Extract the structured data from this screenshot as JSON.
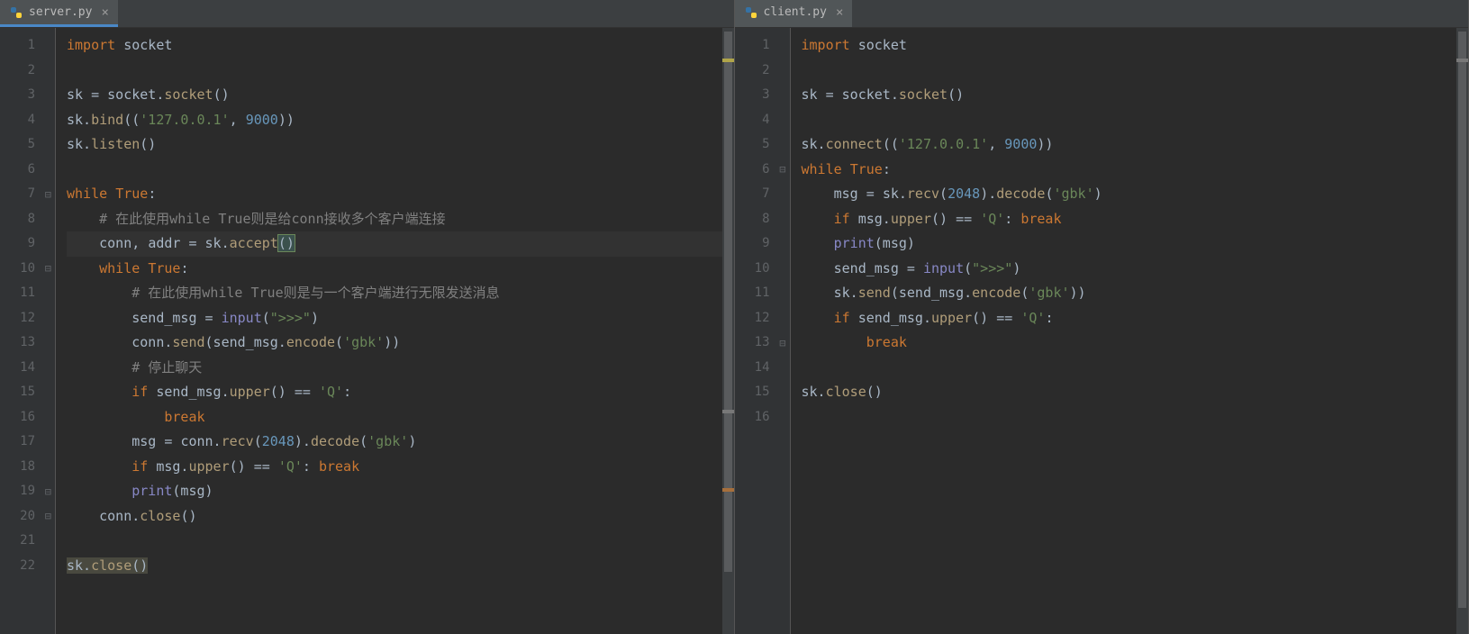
{
  "left": {
    "tab": {
      "filename": "server.py"
    },
    "current_line_index": 8,
    "line_numbers": [
      "1",
      "2",
      "3",
      "4",
      "5",
      "6",
      "7",
      "8",
      "9",
      "10",
      "11",
      "12",
      "13",
      "14",
      "15",
      "16",
      "17",
      "18",
      "19",
      "20",
      "21",
      "22"
    ],
    "fold_marks": {
      "6": "⊟",
      "9": "⊟",
      "18": "⊟",
      "19": "⊟"
    },
    "tokens": [
      [
        {
          "t": "import ",
          "c": "kw"
        },
        {
          "t": "socket",
          "c": "ident"
        }
      ],
      [],
      [
        {
          "t": "sk ",
          "c": "ident"
        },
        {
          "t": "= ",
          "c": "punct"
        },
        {
          "t": "socket.",
          "c": "ident"
        },
        {
          "t": "socket",
          "c": "fncall"
        },
        {
          "t": "()",
          "c": "punct"
        }
      ],
      [
        {
          "t": "sk.",
          "c": "ident"
        },
        {
          "t": "bind",
          "c": "fncall"
        },
        {
          "t": "((",
          "c": "punct"
        },
        {
          "t": "'127.0.0.1'",
          "c": "str"
        },
        {
          "t": ", ",
          "c": "punct"
        },
        {
          "t": "9000",
          "c": "num"
        },
        {
          "t": "))",
          "c": "punct"
        }
      ],
      [
        {
          "t": "sk.",
          "c": "ident"
        },
        {
          "t": "listen",
          "c": "fncall"
        },
        {
          "t": "()",
          "c": "punct"
        }
      ],
      [],
      [
        {
          "t": "while ",
          "c": "kw"
        },
        {
          "t": "True",
          "c": "kw"
        },
        {
          "t": ":",
          "c": "punct"
        }
      ],
      [
        {
          "t": "    ",
          "c": ""
        },
        {
          "t": "# 在此使用while True则是给conn接收多个客户端连接",
          "c": "comment"
        }
      ],
      [
        {
          "t": "    conn",
          "c": "ident"
        },
        {
          "t": ", ",
          "c": "punct"
        },
        {
          "t": "addr ",
          "c": "ident"
        },
        {
          "t": "= ",
          "c": "punct"
        },
        {
          "t": "sk.",
          "c": "ident"
        },
        {
          "t": "accept",
          "c": "fncall"
        },
        {
          "t": "()",
          "c": "punct paren-match"
        }
      ],
      [
        {
          "t": "    ",
          "c": ""
        },
        {
          "t": "while ",
          "c": "kw"
        },
        {
          "t": "True",
          "c": "kw"
        },
        {
          "t": ":",
          "c": "punct"
        }
      ],
      [
        {
          "t": "        ",
          "c": ""
        },
        {
          "t": "# 在此使用while True则是与一个客户端进行无限发送消息",
          "c": "comment"
        }
      ],
      [
        {
          "t": "        send_msg ",
          "c": "ident"
        },
        {
          "t": "= ",
          "c": "punct"
        },
        {
          "t": "input",
          "c": "builtin"
        },
        {
          "t": "(",
          "c": "punct"
        },
        {
          "t": "\">>>\"",
          "c": "str"
        },
        {
          "t": ")",
          "c": "punct"
        }
      ],
      [
        {
          "t": "        conn.",
          "c": "ident"
        },
        {
          "t": "send",
          "c": "fncall"
        },
        {
          "t": "(send_msg.",
          "c": "ident"
        },
        {
          "t": "encode",
          "c": "fncall"
        },
        {
          "t": "(",
          "c": "punct"
        },
        {
          "t": "'gbk'",
          "c": "str"
        },
        {
          "t": "))",
          "c": "punct"
        }
      ],
      [
        {
          "t": "        ",
          "c": ""
        },
        {
          "t": "# 停止聊天",
          "c": "comment"
        }
      ],
      [
        {
          "t": "        ",
          "c": ""
        },
        {
          "t": "if ",
          "c": "kw"
        },
        {
          "t": "send_msg.",
          "c": "ident"
        },
        {
          "t": "upper",
          "c": "fncall"
        },
        {
          "t": "() ",
          "c": "punct"
        },
        {
          "t": "== ",
          "c": "punct"
        },
        {
          "t": "'Q'",
          "c": "str"
        },
        {
          "t": ":",
          "c": "punct"
        }
      ],
      [
        {
          "t": "            ",
          "c": ""
        },
        {
          "t": "break",
          "c": "kw"
        }
      ],
      [
        {
          "t": "        msg ",
          "c": "ident"
        },
        {
          "t": "= ",
          "c": "punct"
        },
        {
          "t": "conn.",
          "c": "ident"
        },
        {
          "t": "recv",
          "c": "fncall"
        },
        {
          "t": "(",
          "c": "punct"
        },
        {
          "t": "2048",
          "c": "num"
        },
        {
          "t": ").",
          "c": "punct"
        },
        {
          "t": "decode",
          "c": "fncall"
        },
        {
          "t": "(",
          "c": "punct"
        },
        {
          "t": "'gbk'",
          "c": "str"
        },
        {
          "t": ")",
          "c": "punct"
        }
      ],
      [
        {
          "t": "        ",
          "c": ""
        },
        {
          "t": "if ",
          "c": "kw"
        },
        {
          "t": "msg.",
          "c": "ident"
        },
        {
          "t": "upper",
          "c": "fncall"
        },
        {
          "t": "() ",
          "c": "punct"
        },
        {
          "t": "== ",
          "c": "punct"
        },
        {
          "t": "'Q'",
          "c": "str"
        },
        {
          "t": ": ",
          "c": "punct"
        },
        {
          "t": "break",
          "c": "kw"
        }
      ],
      [
        {
          "t": "        ",
          "c": ""
        },
        {
          "t": "print",
          "c": "builtin"
        },
        {
          "t": "(msg)",
          "c": "punct"
        }
      ],
      [
        {
          "t": "    conn.",
          "c": "ident"
        },
        {
          "t": "close",
          "c": "fncall"
        },
        {
          "t": "()",
          "c": "punct"
        }
      ],
      [],
      [
        {
          "t": "sk.",
          "c": "ident selection-muted"
        },
        {
          "t": "close",
          "c": "fncall selection-muted"
        },
        {
          "t": "()",
          "c": "punct selection-muted"
        }
      ]
    ],
    "scrollbar_marks": [
      {
        "top": "5%",
        "class": "mark-yellow"
      },
      {
        "top": "63%",
        "class": "mark-gray"
      },
      {
        "top": "76%",
        "class": "mark-orange"
      }
    ]
  },
  "right": {
    "tab": {
      "filename": "client.py"
    },
    "line_numbers": [
      "1",
      "2",
      "3",
      "4",
      "5",
      "6",
      "7",
      "8",
      "9",
      "10",
      "11",
      "12",
      "13",
      "14",
      "15",
      "16"
    ],
    "fold_marks": {
      "5": "⊟",
      "12": "⊟"
    },
    "tokens": [
      [
        {
          "t": "import ",
          "c": "kw"
        },
        {
          "t": "socket",
          "c": "ident"
        }
      ],
      [],
      [
        {
          "t": "sk ",
          "c": "ident"
        },
        {
          "t": "= ",
          "c": "punct"
        },
        {
          "t": "socket.",
          "c": "ident"
        },
        {
          "t": "socket",
          "c": "fncall"
        },
        {
          "t": "()",
          "c": "punct"
        }
      ],
      [],
      [
        {
          "t": "sk.",
          "c": "ident"
        },
        {
          "t": "connect",
          "c": "fncall"
        },
        {
          "t": "((",
          "c": "punct"
        },
        {
          "t": "'127.0.0.1'",
          "c": "str"
        },
        {
          "t": ", ",
          "c": "punct"
        },
        {
          "t": "9000",
          "c": "num"
        },
        {
          "t": "))",
          "c": "punct"
        }
      ],
      [
        {
          "t": "while ",
          "c": "kw"
        },
        {
          "t": "True",
          "c": "kw"
        },
        {
          "t": ":",
          "c": "punct"
        }
      ],
      [
        {
          "t": "    msg ",
          "c": "ident"
        },
        {
          "t": "= ",
          "c": "punct"
        },
        {
          "t": "sk.",
          "c": "ident"
        },
        {
          "t": "recv",
          "c": "fncall"
        },
        {
          "t": "(",
          "c": "punct"
        },
        {
          "t": "2048",
          "c": "num"
        },
        {
          "t": ").",
          "c": "punct"
        },
        {
          "t": "decode",
          "c": "fncall"
        },
        {
          "t": "(",
          "c": "punct"
        },
        {
          "t": "'gbk'",
          "c": "str"
        },
        {
          "t": ")",
          "c": "punct"
        }
      ],
      [
        {
          "t": "    ",
          "c": ""
        },
        {
          "t": "if ",
          "c": "kw"
        },
        {
          "t": "msg.",
          "c": "ident"
        },
        {
          "t": "upper",
          "c": "fncall"
        },
        {
          "t": "() ",
          "c": "punct"
        },
        {
          "t": "== ",
          "c": "punct"
        },
        {
          "t": "'Q'",
          "c": "str"
        },
        {
          "t": ": ",
          "c": "punct"
        },
        {
          "t": "break",
          "c": "kw"
        }
      ],
      [
        {
          "t": "    ",
          "c": ""
        },
        {
          "t": "print",
          "c": "builtin"
        },
        {
          "t": "(msg)",
          "c": "punct"
        }
      ],
      [
        {
          "t": "    send_msg ",
          "c": "ident"
        },
        {
          "t": "= ",
          "c": "punct"
        },
        {
          "t": "input",
          "c": "builtin"
        },
        {
          "t": "(",
          "c": "punct"
        },
        {
          "t": "\">>>\"",
          "c": "str"
        },
        {
          "t": ")",
          "c": "punct"
        }
      ],
      [
        {
          "t": "    sk.",
          "c": "ident"
        },
        {
          "t": "send",
          "c": "fncall"
        },
        {
          "t": "(send_msg.",
          "c": "ident"
        },
        {
          "t": "encode",
          "c": "fncall"
        },
        {
          "t": "(",
          "c": "punct"
        },
        {
          "t": "'gbk'",
          "c": "str"
        },
        {
          "t": "))",
          "c": "punct"
        }
      ],
      [
        {
          "t": "    ",
          "c": ""
        },
        {
          "t": "if ",
          "c": "kw"
        },
        {
          "t": "send_msg.",
          "c": "ident"
        },
        {
          "t": "upper",
          "c": "fncall"
        },
        {
          "t": "() ",
          "c": "punct"
        },
        {
          "t": "== ",
          "c": "punct"
        },
        {
          "t": "'Q'",
          "c": "str"
        },
        {
          "t": ":",
          "c": "punct"
        }
      ],
      [
        {
          "t": "        ",
          "c": ""
        },
        {
          "t": "break",
          "c": "kw"
        }
      ],
      [],
      [
        {
          "t": "sk.",
          "c": "ident"
        },
        {
          "t": "close",
          "c": "fncall"
        },
        {
          "t": "()",
          "c": "punct"
        }
      ],
      []
    ],
    "scrollbar_marks": [
      {
        "top": "5%",
        "class": "mark-gray"
      }
    ]
  }
}
